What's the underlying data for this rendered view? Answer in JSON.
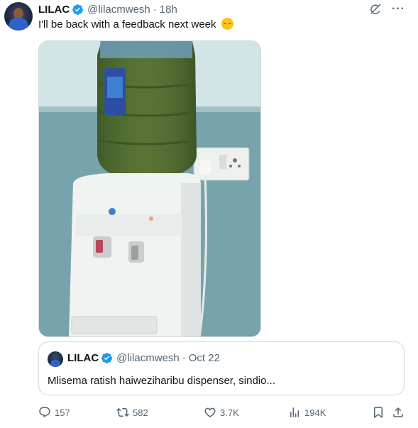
{
  "tweet": {
    "author_name": "LILAC",
    "handle": "@lilacmwesh",
    "separator": "·",
    "time": "18h",
    "text": "I'll be back with a feedback next week",
    "emoji_icon": "relieved-face-emoji"
  },
  "quoted_tweet": {
    "author_name": "LILAC",
    "handle": "@lilacmwesh",
    "separator": "·",
    "date": "Oct 22",
    "text": "Mlisema ratish haiweziharibu dispenser, sindio..."
  },
  "actions": {
    "replies": "157",
    "reposts": "582",
    "likes": "3.7K",
    "views": "194K"
  },
  "colors": {
    "verified_blue": "#1d9bf0",
    "secondary_text": "#536471",
    "border": "#cfd9de",
    "water_green": "#4f6a2c"
  }
}
